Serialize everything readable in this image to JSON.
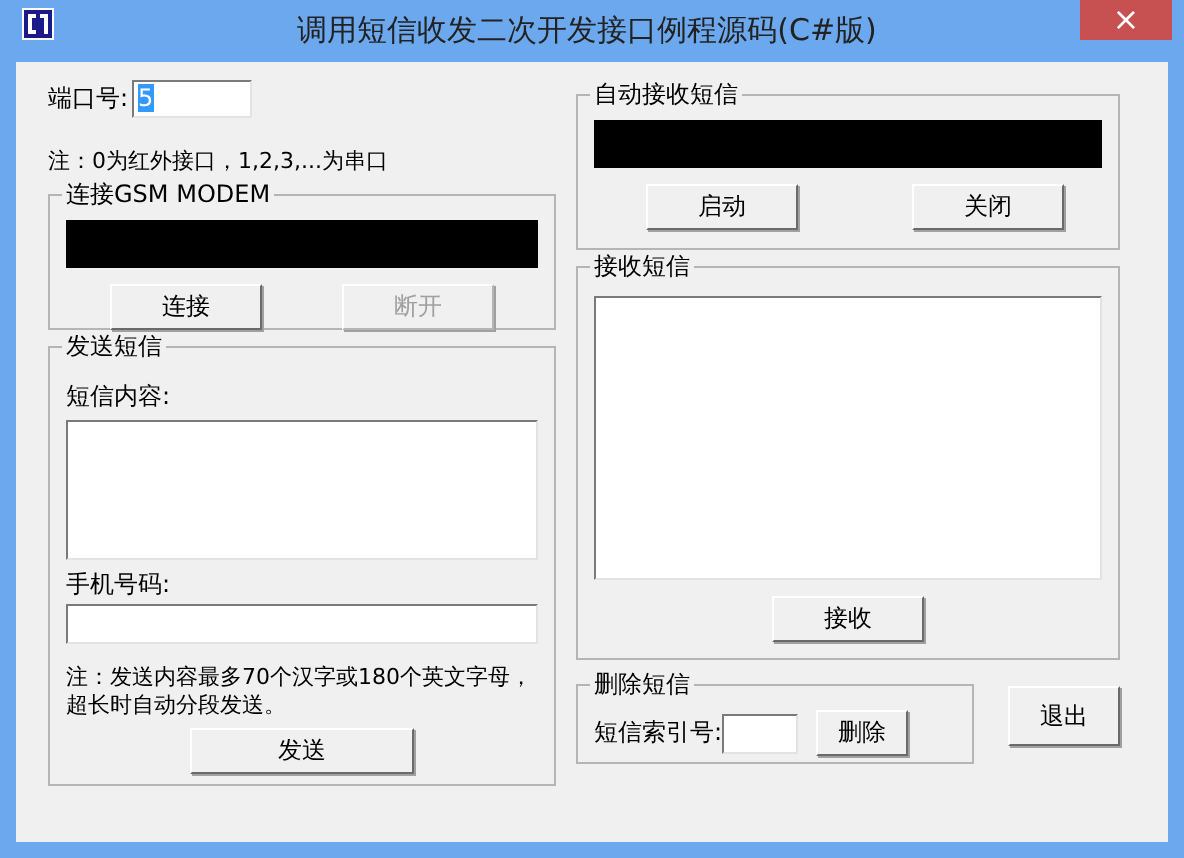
{
  "window": {
    "title": "调用短信收发二次开发接口例程源码(C#版)",
    "close": "×"
  },
  "port": {
    "label": "端口号:",
    "value": "5",
    "highlighted": true
  },
  "port_note": "注：0为红外接口，1,2,3,...为串口",
  "connect_group": {
    "title": "连接GSM MODEM",
    "buttons": [
      {
        "label": "连接",
        "disabled": false
      },
      {
        "label": "断开",
        "disabled": true
      }
    ]
  },
  "send_group": {
    "title": "发送短信",
    "content_label": "短信内容:",
    "phone_label": "手机号码:",
    "note": "注：发送内容最多70个汉字或180个英文字母，超长时自动分段发送。",
    "button": {
      "label": "发送",
      "disabled": false
    }
  },
  "auto_receive_group": {
    "title": "自动接收短信",
    "buttons": [
      {
        "label": "启动",
        "disabled": false
      },
      {
        "label": "关闭",
        "disabled": false
      }
    ]
  },
  "receive_group": {
    "title": "接收短信",
    "button": {
      "label": "接收",
      "disabled": false
    }
  },
  "delete_group": {
    "title": "删除短信",
    "index_label": "短信索引号:",
    "button": {
      "label": "删除",
      "disabled": false
    }
  },
  "exit_button": {
    "label": "退出",
    "disabled": false
  }
}
